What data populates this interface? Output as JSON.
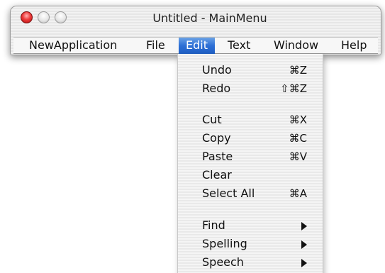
{
  "window": {
    "title": "Untitled - MainMenu"
  },
  "menubar": {
    "items": [
      {
        "label": "NewApplication"
      },
      {
        "label": "File"
      },
      {
        "label": "Edit"
      },
      {
        "label": "Text"
      },
      {
        "label": "Window"
      },
      {
        "label": "Help"
      }
    ],
    "active": "Edit",
    "active_color": "#2d6fd6"
  },
  "edit_menu": {
    "items": [
      {
        "label": "Undo",
        "shortcut": "⌘Z"
      },
      {
        "label": "Redo",
        "shortcut": "⇧⌘Z"
      },
      {
        "label": "Cut",
        "shortcut": "⌘X"
      },
      {
        "label": "Copy",
        "shortcut": "⌘C"
      },
      {
        "label": "Paste",
        "shortcut": "⌘V"
      },
      {
        "label": "Clear",
        "shortcut": ""
      },
      {
        "label": "Select All",
        "shortcut": "⌘A"
      },
      {
        "label": "Find",
        "submenu": true
      },
      {
        "label": "Spelling",
        "submenu": true
      },
      {
        "label": "Speech",
        "submenu": true
      }
    ]
  }
}
